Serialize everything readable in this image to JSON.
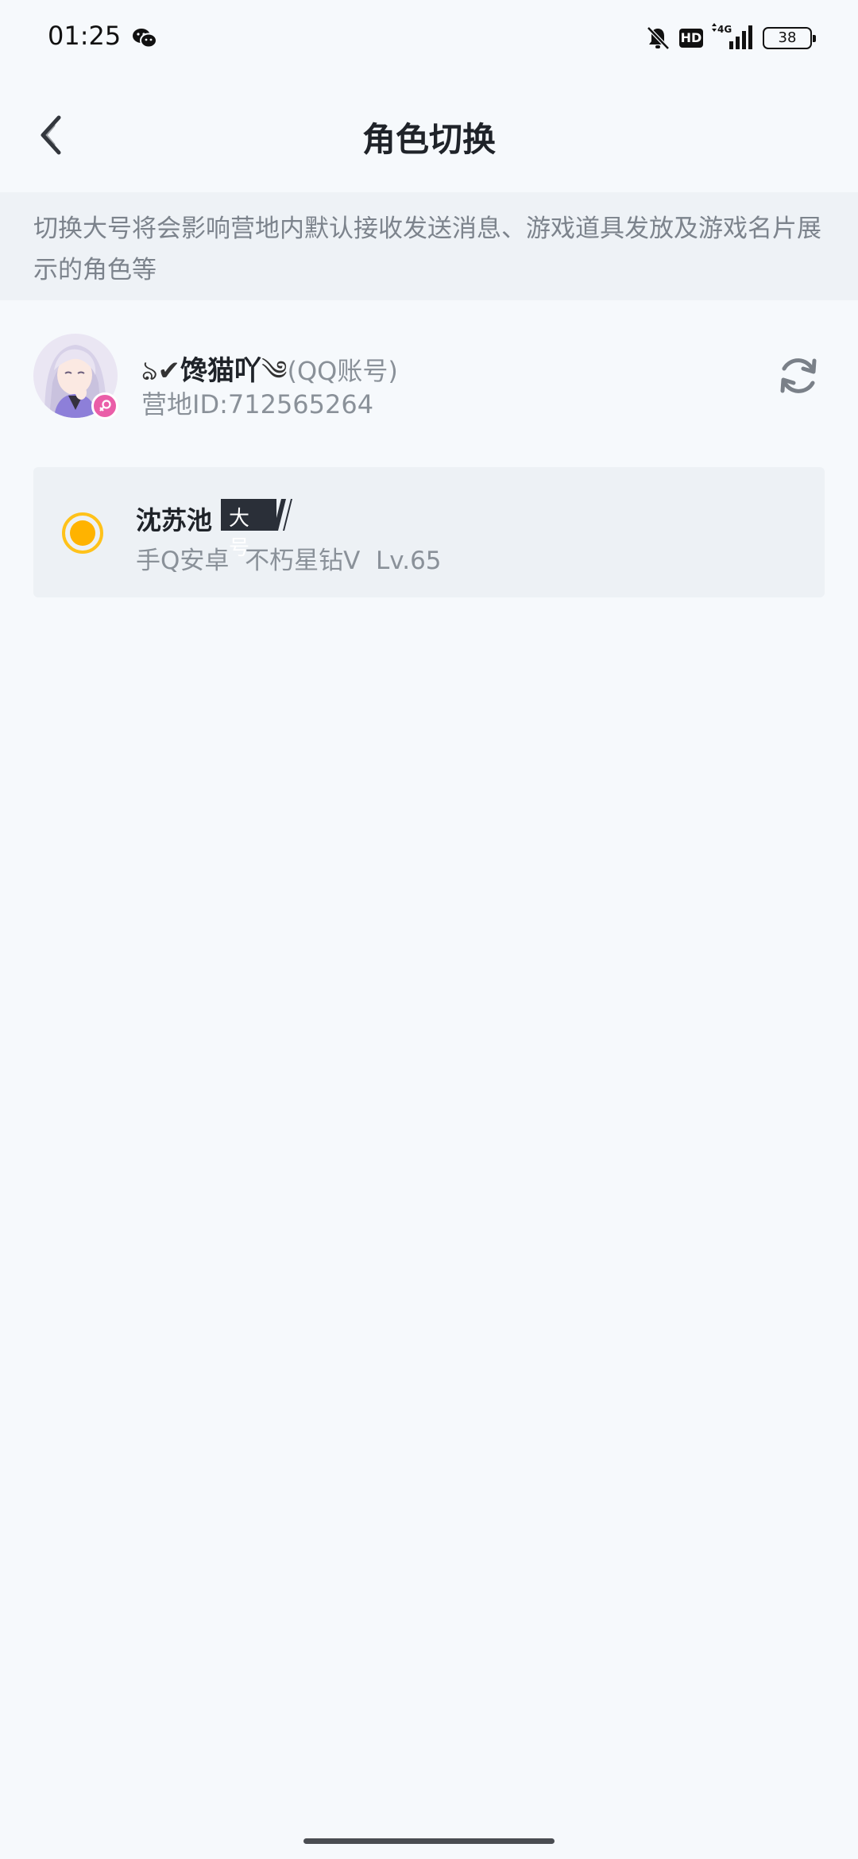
{
  "status_bar": {
    "time": "01:25",
    "network": "4G",
    "battery": "38",
    "hd_label": "HD",
    "icons": [
      "wechat-icon",
      "mute-bell-icon",
      "hd-icon",
      "signal-icon",
      "battery-icon"
    ]
  },
  "nav": {
    "title": "角色切换",
    "back_icon": "chevron-left-icon"
  },
  "notice": {
    "text": "切换大号将会影响营地内默认接收发送消息、游戏道具发放及游戏名片展示的角色等"
  },
  "account": {
    "name_prefix": "ঌ✔",
    "nickname": "馋猫吖",
    "name_suffix": "༄",
    "account_type": "(QQ账号)",
    "camp_id": "营地ID:712565264",
    "gender_icon": "female-icon",
    "refresh_icon": "refresh-icon"
  },
  "roles": [
    {
      "name": "沈苏池",
      "badge": "大号",
      "info": "手Q安卓  不朽星钻V  Lv.65",
      "selected": true
    }
  ],
  "colors": {
    "background": "#f6f9fc",
    "notice_bg": "#eef2f6",
    "card_bg": "#edf1f5",
    "radio_accent": "#ffb300",
    "gender_badge": "#ea5ea8",
    "badge_dark": "#2a2f38"
  }
}
